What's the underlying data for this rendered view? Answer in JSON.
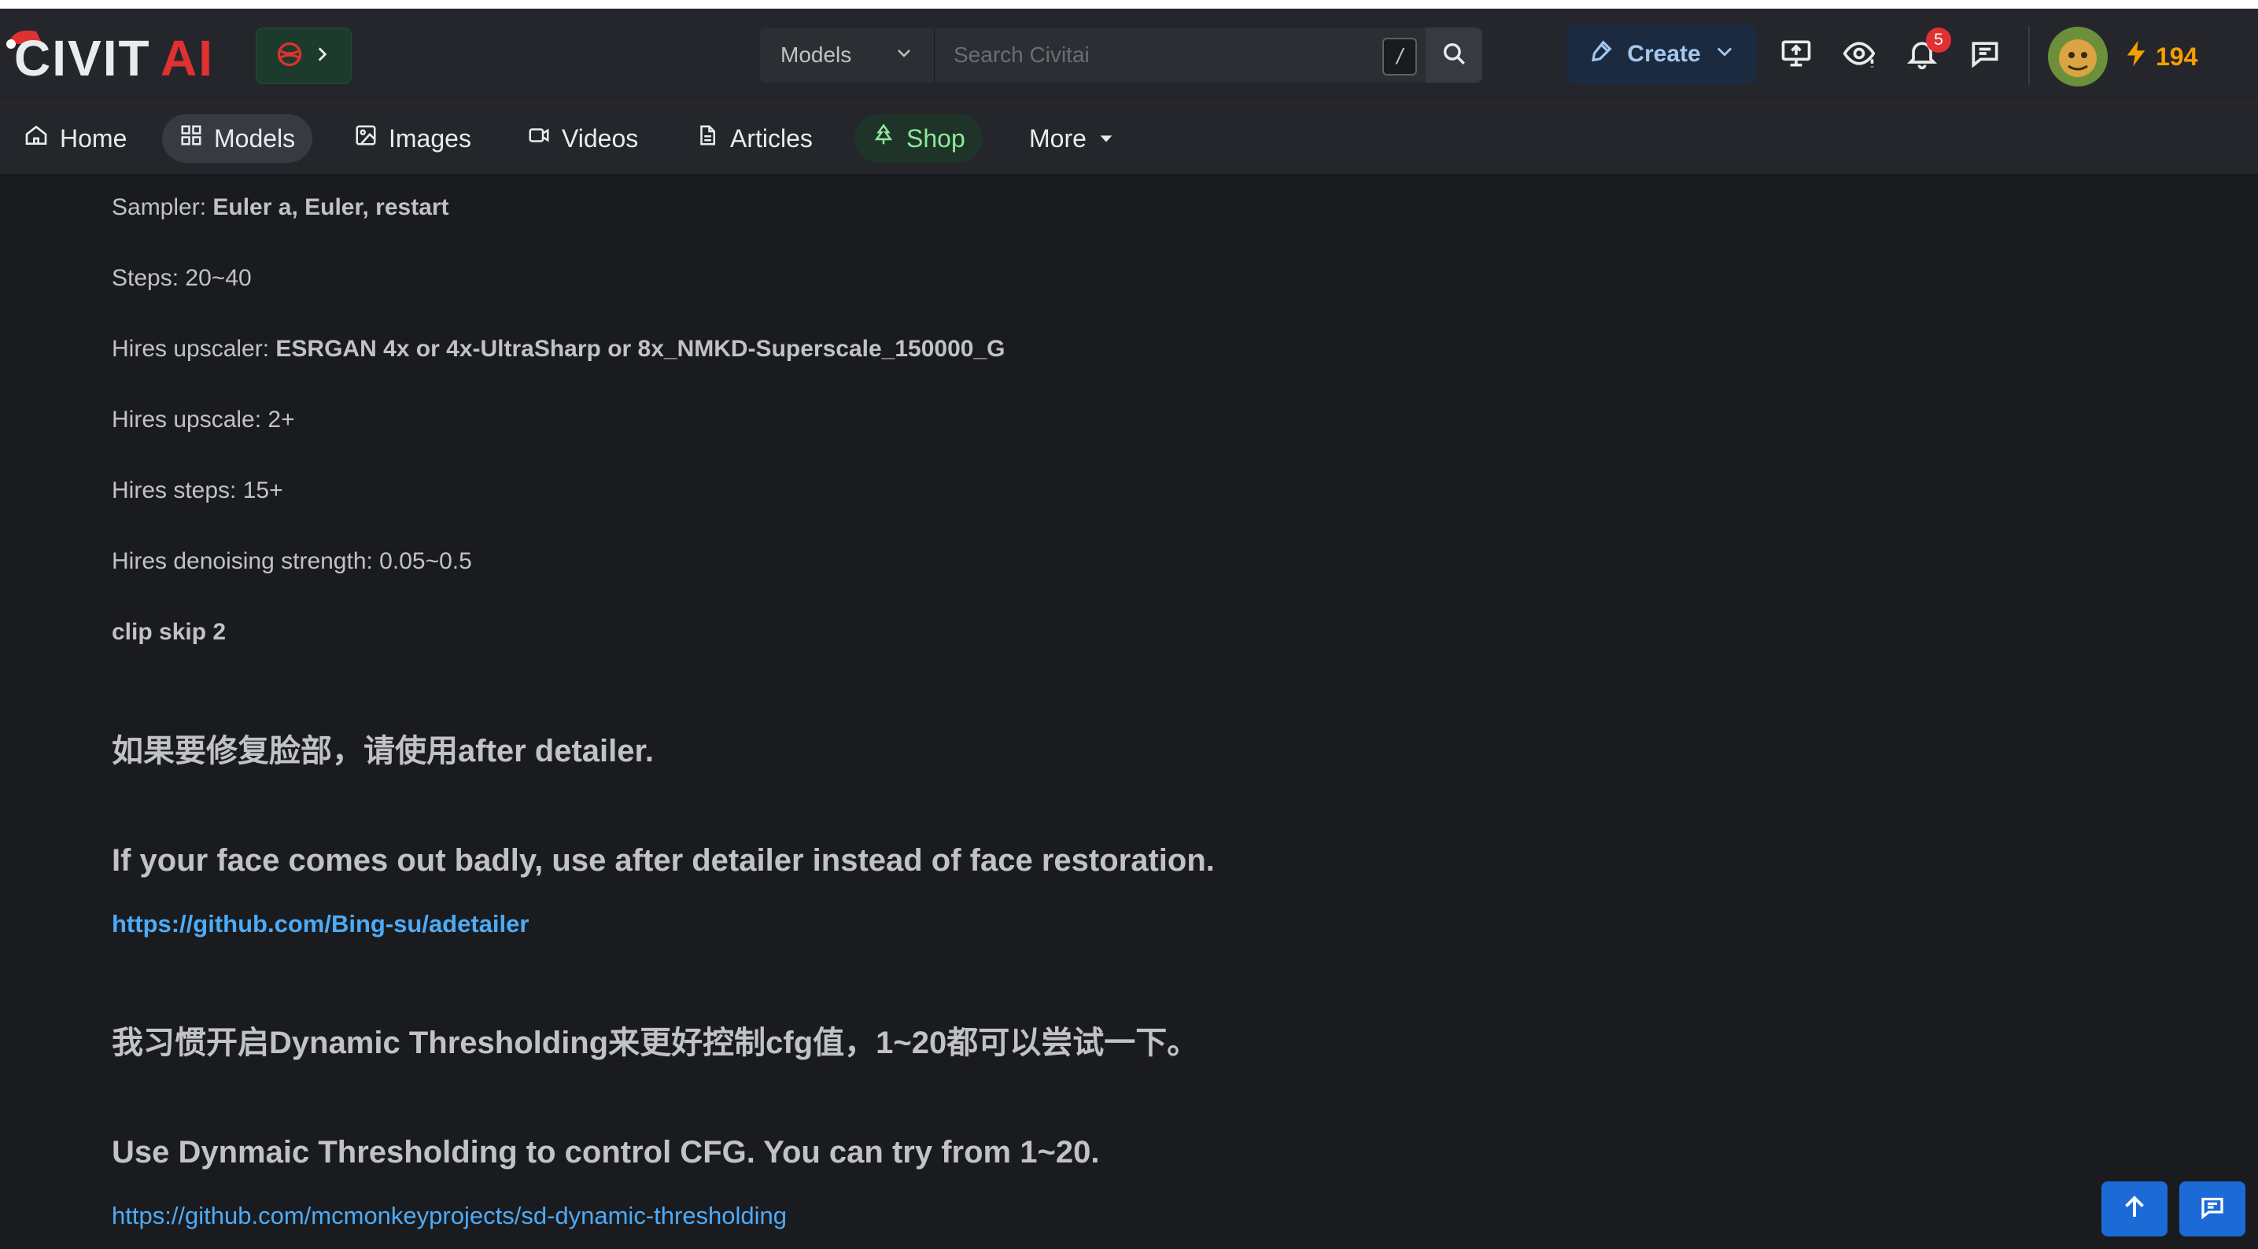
{
  "header": {
    "logo_text": "CIVITAI",
    "search": {
      "category": "Models",
      "placeholder": "Search Civitai",
      "shortcut": "/"
    },
    "create_label": "Create",
    "notifications_count": "5",
    "buzz_amount": "194"
  },
  "nav": {
    "items": [
      {
        "label": "Home",
        "icon": "home-icon"
      },
      {
        "label": "Models",
        "icon": "grid-icon",
        "active": true
      },
      {
        "label": "Images",
        "icon": "image-icon"
      },
      {
        "label": "Videos",
        "icon": "video-icon"
      },
      {
        "label": "Articles",
        "icon": "article-icon"
      },
      {
        "label": "Shop",
        "icon": "tree-icon"
      },
      {
        "label": "More",
        "icon": "caret-down-icon"
      }
    ]
  },
  "content": {
    "sampler": {
      "label": "Sampler: ",
      "value": "Euler a, Euler, restart"
    },
    "steps": "Steps: 20~40",
    "hires_upscaler": {
      "label": "Hires upscaler: ",
      "value": "ESRGAN 4x or 4x-UltraSharp or 8x_NMKD-Superscale_150000_G"
    },
    "hires_upscale": "Hires upscale: 2+",
    "hires_steps": "Hires steps: 15+",
    "hires_denoise": "Hires denoising strength: 0.05~0.5",
    "clip_skip": "clip skip 2",
    "face_cn": "如果要修复脸部，请使用after detailer.",
    "face_en": "If your face comes out badly, use after detailer instead of face restoration.",
    "adetailer_link": "https://github.com/Bing-su/adetailer",
    "dyn_cn": "我习惯开启Dynamic Thresholding来更好控制cfg值，1~20都可以尝试一下。",
    "dyn_en": "Use Dynmaic Thresholding to control CFG. You can try from 1~20.",
    "dyn_link": "https://github.com/mcmonkeyprojects/sd-dynamic-thresholding"
  },
  "colors": {
    "accent_blue": "#1c6ad6",
    "link": "#4dabf7",
    "buzz": "#f59f00",
    "badge": "#e03131"
  }
}
